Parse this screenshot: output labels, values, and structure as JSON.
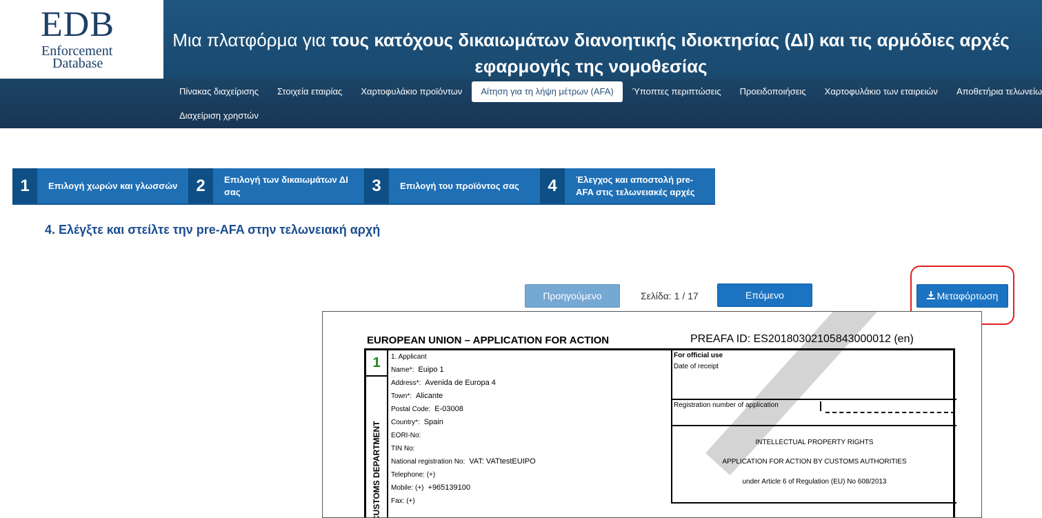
{
  "logo": {
    "big": "EDB",
    "line1": "Enforcement",
    "line2": "Database"
  },
  "header": {
    "title_plain": "Μια πλατφόρμα για ",
    "title_bold": "τους κατόχους δικαιωμάτων διανοητικής ιδιοκτησίας (ΔΙ) και τις αρμόδιες αρχές",
    "title_line2": "εφαρμογής της νομοθεσίας"
  },
  "nav": {
    "items": [
      "Πίνακας διαχείρισης",
      "Στοιχεία εταιρίας",
      "Χαρτοφυλάκιο προϊόντων",
      "Αίτηση για τη λήψη μέτρων (AFA)",
      "Ύποπτες περιπτώσεις",
      "Προειδοποιήσεις",
      "Χαρτοφυλάκιο των εταιρειών",
      "Αποθετήρια τελωνείων και"
    ],
    "second_row": "Διαχείριση χρηστών"
  },
  "steps": [
    {
      "num": "1",
      "label": "Επιλογή χωρών και γλωσσών"
    },
    {
      "num": "2",
      "label": "Επιλογή των δικαιωμάτων ΔΙ σας"
    },
    {
      "num": "3",
      "label": "Επιλογή του προϊόντος σας"
    },
    {
      "num": "4",
      "label": "Έλεγχος και αποστολή pre-AFA στις τελωνειακές αρχές"
    }
  ],
  "page_heading": "4. Ελέγξτε και στείλτε την pre-AFA στην τελωνειακή αρχή",
  "pager": {
    "prev": "Προηγούμενο",
    "info": "Σελίδα: 1 / 17",
    "next": "Επόμενο",
    "download": "Μεταφόρτωση"
  },
  "document": {
    "title": "EUROPEAN UNION – APPLICATION FOR ACTION",
    "preafa_id": "PREAFA ID: ES20180302105843000012 (en)",
    "section_number": "1",
    "vertical_label": "CUSTOMS DEPARTMENT",
    "fields": [
      {
        "label": "1. Applicant",
        "value": ""
      },
      {
        "label": "Name*:",
        "value": "Euipo 1"
      },
      {
        "label": "Address*:",
        "value": "Avenida de Europa 4"
      },
      {
        "label": "Town*:",
        "value": "Alicante"
      },
      {
        "label": "Postal Code:",
        "value": "E-03008"
      },
      {
        "label": "Country*:",
        "value": "Spain"
      },
      {
        "label": "EORI-No:",
        "value": ""
      },
      {
        "label": "TIN No:",
        "value": ""
      },
      {
        "label": "National registration No:",
        "value": "VAT: VATtestEUIPO"
      },
      {
        "label": "Telephone: (+)",
        "value": ""
      },
      {
        "label": "Mobile: (+)",
        "value": "+965139100"
      },
      {
        "label": "Fax: (+)",
        "value": ""
      }
    ],
    "official": {
      "heading": "For official use",
      "date_of_receipt": "Date of receipt",
      "registration": "Registration number of application",
      "ipr": "INTELLECTUAL PROPERTY RIGHTS",
      "afa": "APPLICATION FOR ACTION BY CUSTOMS AUTHORITIES",
      "article": "under Article 6 of Regulation (EU) No 608/2013"
    }
  }
}
